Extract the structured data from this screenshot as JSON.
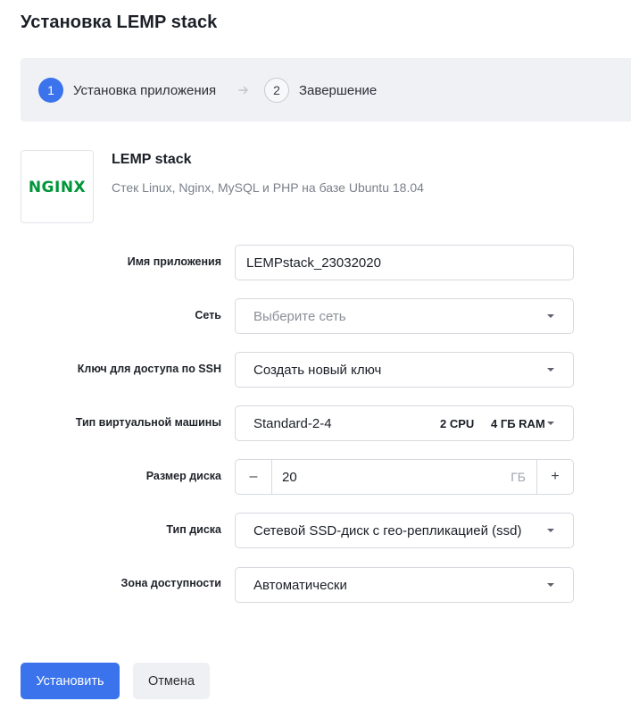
{
  "page": {
    "title": "Установка LEMP stack"
  },
  "steps": [
    {
      "number": "1",
      "label": "Установка приложения",
      "active": true
    },
    {
      "number": "2",
      "label": "Завершение",
      "active": false
    }
  ],
  "app": {
    "logo_text": "NGINX",
    "logo_color": "#009639",
    "name": "LEMP stack",
    "description": "Стек Linux, Nginx, MySQL и PHP на базе Ubuntu 18.04"
  },
  "form": {
    "app_name": {
      "label": "Имя приложения",
      "value": "LEMPstack_23032020"
    },
    "network": {
      "label": "Сеть",
      "placeholder": "Выберите сеть"
    },
    "ssh_key": {
      "label": "Ключ для доступа по SSH",
      "value": "Создать новый ключ"
    },
    "vm_type": {
      "label": "Тип виртуальной машины",
      "value": "Standard-2-4",
      "cpu": "2 CPU",
      "ram": "4 ГБ RAM"
    },
    "disk_size": {
      "label": "Размер диска",
      "value": "20",
      "unit": "ГБ",
      "minus": "–",
      "plus": "+"
    },
    "disk_type": {
      "label": "Тип диска",
      "value": "Сетевой SSD-диск с гео-репликацией (ssd)"
    },
    "zone": {
      "label": "Зона доступности",
      "value": "Автоматически"
    }
  },
  "actions": {
    "install": "Установить",
    "cancel": "Отмена"
  },
  "colors": {
    "primary": "#3a73eb",
    "stepper_bg": "#eff1f4"
  }
}
